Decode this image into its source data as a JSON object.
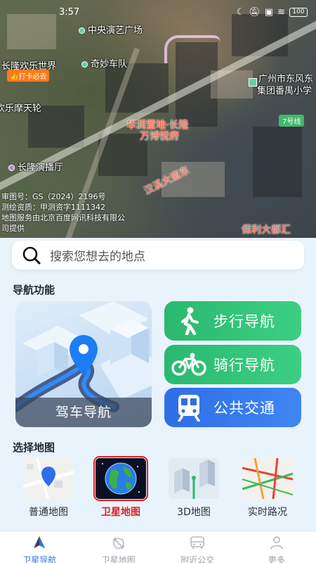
{
  "status": {
    "time": "3:57",
    "battery": "100"
  },
  "map": {
    "labels": {
      "center_plaza": "中央演艺广场",
      "changlong_world": "长隆欢乐世界",
      "checkin": "打卡必去",
      "qimiao": "奇妙车队",
      "ferris": "欢乐摩天轮",
      "changlong_theater": "长隆演播厅",
      "huarun_1": "华润置地·长隆",
      "huarun_2": "万博悦府",
      "school_1": "广州市东风东",
      "school_2": "集团番禺小学",
      "line7": "7号线",
      "hanxi": "汉溪大道东",
      "poly": "保利大都汇"
    },
    "copyright": [
      "审图号：GS（2024）2196号",
      "测绘资质：甲测资字1111342",
      "地图服务由北京百度网讯科技有限公",
      "司提供"
    ]
  },
  "search": {
    "placeholder": "搜索您想去的地点"
  },
  "nav": {
    "title": "导航功能",
    "drive": "驾车导航",
    "walk": "步行导航",
    "ride": "骑行导航",
    "bus": "公共交通"
  },
  "maptypes": {
    "title": "选择地图",
    "items": [
      "普通地图",
      "卫星地图",
      "3D地图",
      "实时路况"
    ],
    "selected": "卫星地图"
  },
  "tabs": [
    "卫星导航",
    "卫星地图",
    "附近公交",
    "更多"
  ],
  "colors": {
    "accent": "#2a73e8",
    "green": "#2bb870",
    "blue": "#2f6ee6",
    "selected": "#d9222a"
  }
}
